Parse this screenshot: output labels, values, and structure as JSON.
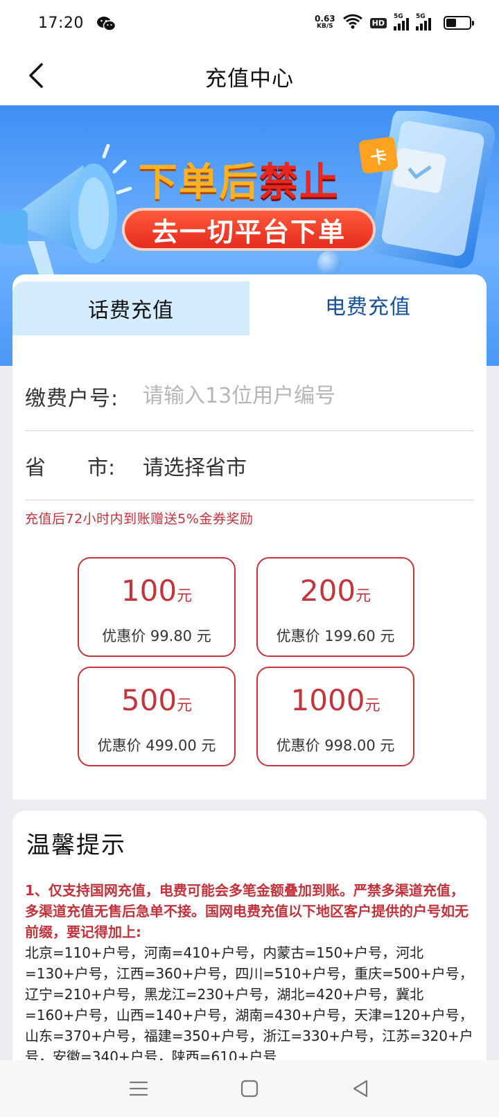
{
  "status_bar": {
    "time": "17:20",
    "net_speed_value": "0.63",
    "net_speed_unit": "KB/S",
    "hd_label": "HD",
    "sim1_label": "5G",
    "sim2_label": "5G",
    "icons": [
      "wechat-icon",
      "wifi-icon",
      "signal-icon",
      "battery-icon"
    ]
  },
  "header": {
    "title": "充值中心",
    "back_icon": "chevron-left-icon"
  },
  "banner": {
    "line1_orange": "下单后",
    "line1_red": "禁止",
    "line2": "去一切平台下单",
    "card_badge": "卡"
  },
  "tabs": [
    {
      "label": "话费充值",
      "active": false
    },
    {
      "label": "电费充值",
      "active": true
    }
  ],
  "form": {
    "account_label": "缴费户号:",
    "account_placeholder": "请输入13位用户编号",
    "account_value": "",
    "region_label": "省　　市:",
    "region_value": "请选择省市",
    "promo_note": "充值后72小时内到账赠送5%金券奖励"
  },
  "amounts": [
    {
      "value": "100",
      "unit": "元",
      "price_label": "优惠价 99.80 元"
    },
    {
      "value": "200",
      "unit": "元",
      "price_label": "优惠价 199.60 元"
    },
    {
      "value": "500",
      "unit": "元",
      "price_label": "优惠价 499.00 元"
    },
    {
      "value": "1000",
      "unit": "元",
      "price_label": "优惠价 998.00 元"
    }
  ],
  "tips": {
    "title": "温馨提示",
    "red_text": "1、仅支持国网充值，电费可能会多笔金额叠加到账。严禁多渠道充值，多渠道充值无售后急单不接。国网电费充值以下地区客户提供的户号如无前缀，要记得加上:",
    "regions_text": " 北京=110+户号，河南=410+户号，内蒙古=150+户号，河北=130+户号，江西=360+户号，四川=510+户号，重庆=500+户号，辽宁=210+户号，黑龙江=230+户号，湖北=420+户号，冀北=160+户号，山西=140+户号，湖南=430+户号，天津=120+户号，山东=370+户号，福建=350+户号，浙江=330+户号，江苏=320+户号，安徽=340+户号，陕西=610+户号"
  },
  "colors": {
    "accent_red": "#c4353b",
    "tab_active_text": "#16519a",
    "tab_inactive_bg": "#d4ecff",
    "banner_blue": "#3f8ef4"
  },
  "nav": {
    "icons": [
      "menu-icon",
      "home-square-icon",
      "back-triangle-icon"
    ]
  }
}
